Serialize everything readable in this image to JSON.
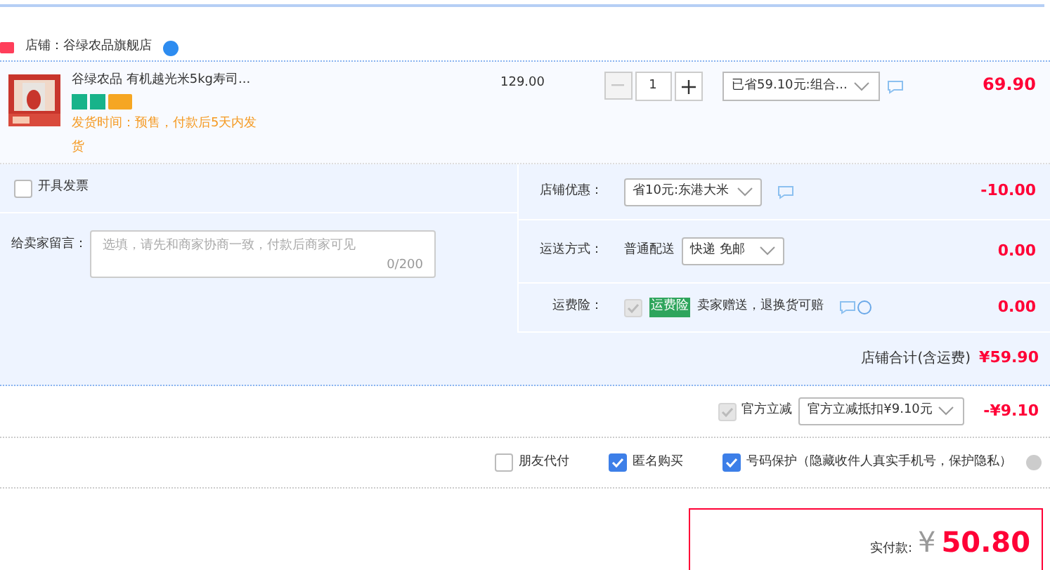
{
  "shop": {
    "label": "店铺：谷绿农品旗舰店"
  },
  "item": {
    "title": "谷绿农品 有机越光米5kg寿司...",
    "ship_note": "发货时间：预售，付款后5天内发货",
    "price": "129.00",
    "quantity": "1",
    "minus_disabled": true,
    "promo": "已省59.10元:组合...",
    "subtotal": "69.90"
  },
  "invoice": {
    "label": "开具发票",
    "checked": false
  },
  "message": {
    "label": "给卖家留言：",
    "placeholder": "选填，请先和商家协商一致，付款后商家可见",
    "counter": "0/200"
  },
  "rows": [
    {
      "kind": "select",
      "label": "店铺优惠：",
      "select": "省10元:东港大米",
      "amount": "-10.00"
    },
    {
      "kind": "shipping",
      "label": "运送方式：",
      "prefix": "普通配送",
      "select": "快递 免邮",
      "amount": "0.00"
    },
    {
      "kind": "insurance",
      "label": "运费险：",
      "checked": true,
      "tag": "运费险",
      "text": "卖家赠送，退换货可赔",
      "amount": "0.00"
    }
  ],
  "shop_total": {
    "label": "店铺合计(含运费)",
    "amount": "¥59.90"
  },
  "official": {
    "checked": true,
    "label": "官方立减",
    "select": "官方立减抵扣¥9.10元",
    "amount": "-¥9.10"
  },
  "options": [
    {
      "label": "朋友代付",
      "checked": false
    },
    {
      "label": "匿名购买",
      "checked": true
    },
    {
      "label": "号码保护（隐藏收件人真实手机号，保护隐私）",
      "checked": true
    }
  ],
  "pay": {
    "label": "实付款:",
    "currency": "¥",
    "amount": "50.80"
  }
}
